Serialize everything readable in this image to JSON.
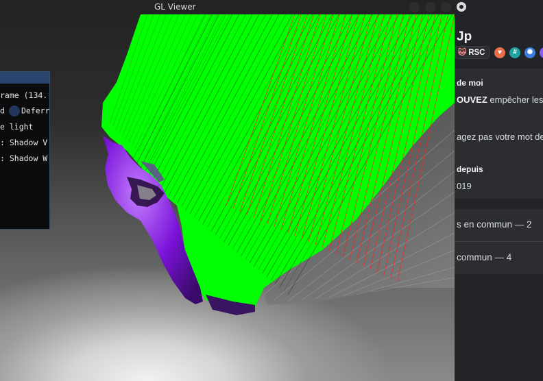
{
  "gl_viewer": {
    "title": "GL Viewer",
    "debug_panel": {
      "rows": [
        "rame (134.",
        "d",
        "Deferr",
        "e light",
        ": Shadow V",
        ": Shadow W"
      ]
    }
  },
  "profile": {
    "name": "Jp",
    "tag": "RSC",
    "badges": [
      {
        "icon": "heart-badge-icon",
        "color": "#e8704c",
        "glyph": "♥"
      },
      {
        "icon": "hashtag-badge-icon",
        "color": "#1fa3a0",
        "glyph": "#"
      },
      {
        "icon": "cog-badge-icon",
        "color": "#3d7de0",
        "glyph": "✺"
      },
      {
        "icon": "aura-badge-icon",
        "color": "#8a5cf6",
        "glyph": "○"
      }
    ],
    "about_heading": "de moi",
    "about_line1_bold": "OUVEZ",
    "about_line1_rest": " empêcher les",
    "about_line2": "agez pas votre mot de",
    "member_since_heading": "depuis",
    "member_since_value": "019",
    "mutual_servers": "s en commun — 2",
    "mutual_friends": " commun — 4"
  },
  "colors": {
    "hair_green": "#00ff00",
    "hair_red": "#ff0000",
    "mesh_purple": "#8a1fe0",
    "accent_blue": "#29446d"
  }
}
